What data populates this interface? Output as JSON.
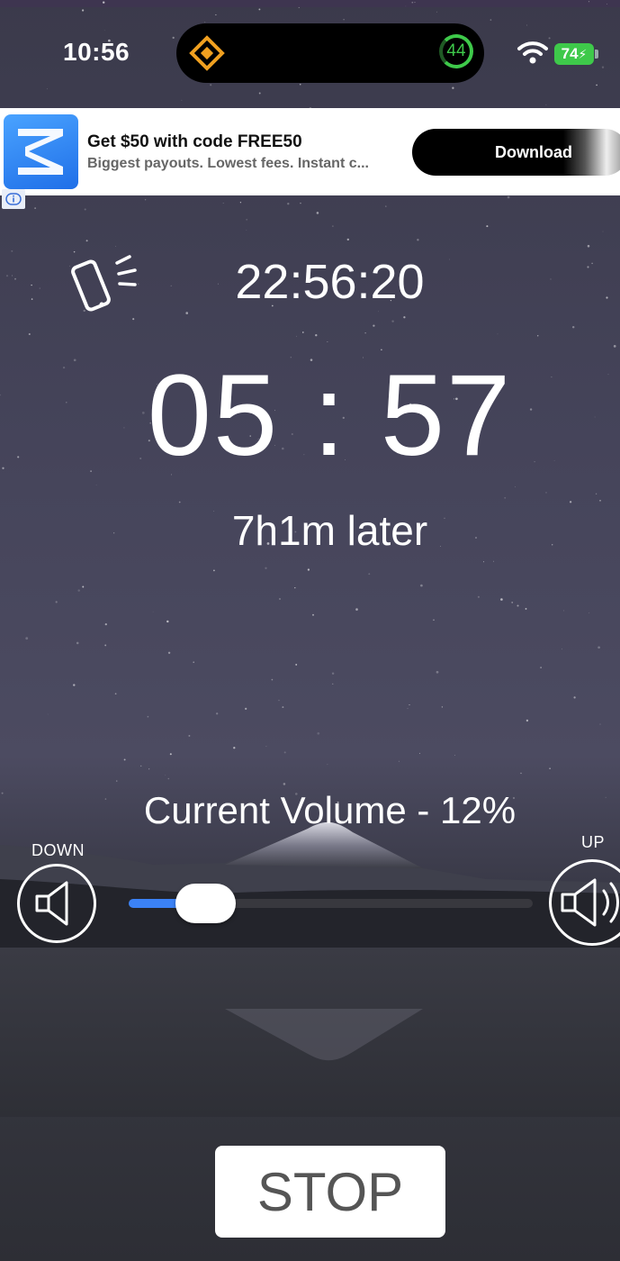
{
  "status_bar": {
    "time": "10:56",
    "island_badge": "44",
    "battery": "74",
    "icons": [
      "diamond-app-icon",
      "wifi-icon",
      "battery-charging-icon"
    ]
  },
  "ad": {
    "title": "Get $50 with code FREE50",
    "subtitle": "Biggest payouts. Lowest fees. Instant c...",
    "button_label": "Download",
    "info_icon": "info-icon"
  },
  "alarm": {
    "clock": "22:56:20",
    "countdown": "05 : 57",
    "later": "7h1m later",
    "vibrate_icon": "vibrate-phone-icon"
  },
  "volume": {
    "title": "Current Volume - 12%",
    "level": 0.12,
    "down_label": "DOWN",
    "up_label": "UP",
    "accent": "#3b82f6"
  },
  "stop": {
    "label": "STOP"
  }
}
